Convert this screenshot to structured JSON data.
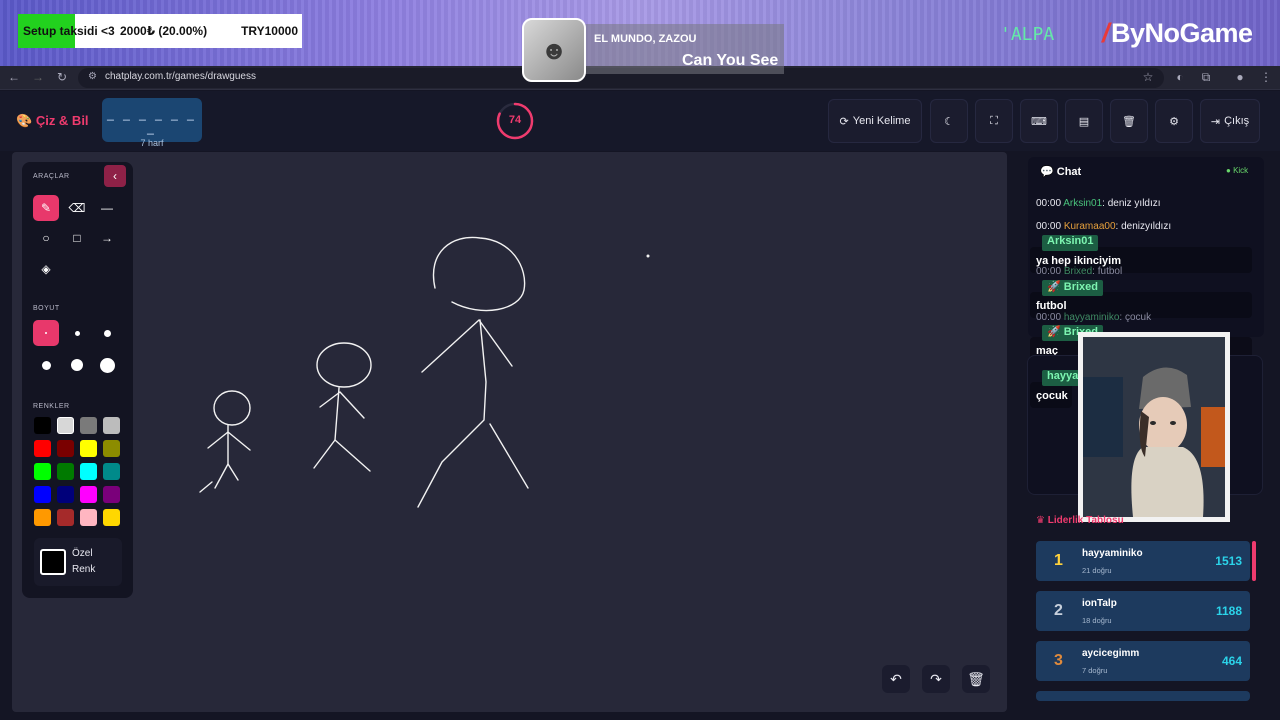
{
  "stream_overlay": {
    "goal": {
      "label": "Setup taksidi <3",
      "amount": "2000₺ (20.00%)",
      "target": "TRY10000",
      "progress": 0.2
    },
    "now_playing": {
      "artist": "EL MUNDO, ZAZOU",
      "title": "Can You See"
    },
    "brands": {
      "alpa": "'ALPA",
      "bynogame": "ByNoGame"
    }
  },
  "browser": {
    "url": "chatplay.com.tr/games/drawguess"
  },
  "app": {
    "logo": "Çiz & Bil",
    "word": {
      "dashes": "_ _ _ _ _ _ _",
      "hint": "7 harf"
    },
    "timer": {
      "value": "74",
      "fraction": 0.82
    },
    "buttons": {
      "new_word": "Yeni Kelime",
      "exit": "Çıkış"
    }
  },
  "toolbar": {
    "tools_title": "ARAÇLAR",
    "size_title": "BOYUT",
    "colors_title": "RENKLER",
    "custom_color": "Özel Renk",
    "colors": [
      "#000000",
      "#d7d7d7",
      "#7a7a7a",
      "#bcbcbc",
      "#ff0000",
      "#7a0000",
      "#ffff00",
      "#8c8c00",
      "#00ff00",
      "#007a00",
      "#00ffff",
      "#008a8a",
      "#0000ff",
      "#00007a",
      "#ff00ff",
      "#7a007a",
      "#ff9900",
      "#a52a2a",
      "#ffb6c1",
      "#ffd700"
    ]
  },
  "chat": {
    "title": "Chat",
    "platform": "Kick",
    "messages": [
      {
        "time": "00:00",
        "user": "Arksin01",
        "text": "deniz yıldızı",
        "color": "#49c47c"
      },
      {
        "time": "00:00",
        "user": "Kuramaa00",
        "text": "denizyıldızı",
        "color": "#e6a03c"
      },
      {
        "time": "00:00",
        "user": "Brixed",
        "text": "futbol",
        "color": "#49c47c"
      },
      {
        "time": "00:00",
        "user": "hayyaminiko",
        "text": "çocuk",
        "color": "#49c47c"
      }
    ],
    "overlay_messages": [
      {
        "user": "Arksin01",
        "text": "ya hep ikinciyim"
      },
      {
        "user": "Brixed",
        "text": "futbol"
      },
      {
        "user": "Brixed",
        "text": "maç"
      },
      {
        "user": "hayya",
        "text": "çocuk"
      }
    ]
  },
  "leaderboard": {
    "title": "Liderlik Tablosu",
    "rows": [
      {
        "rank": "1",
        "name": "hayyaminiko",
        "sub": "21 doğru",
        "score": "1513",
        "rank_color": "#ffd23c"
      },
      {
        "rank": "2",
        "name": "ionTalp",
        "sub": "18 doğru",
        "score": "1188",
        "rank_color": "#c8d0dc"
      },
      {
        "rank": "3",
        "name": "aycicegimm",
        "sub": "7 doğru",
        "score": "464",
        "rank_color": "#e08a3c"
      }
    ]
  }
}
